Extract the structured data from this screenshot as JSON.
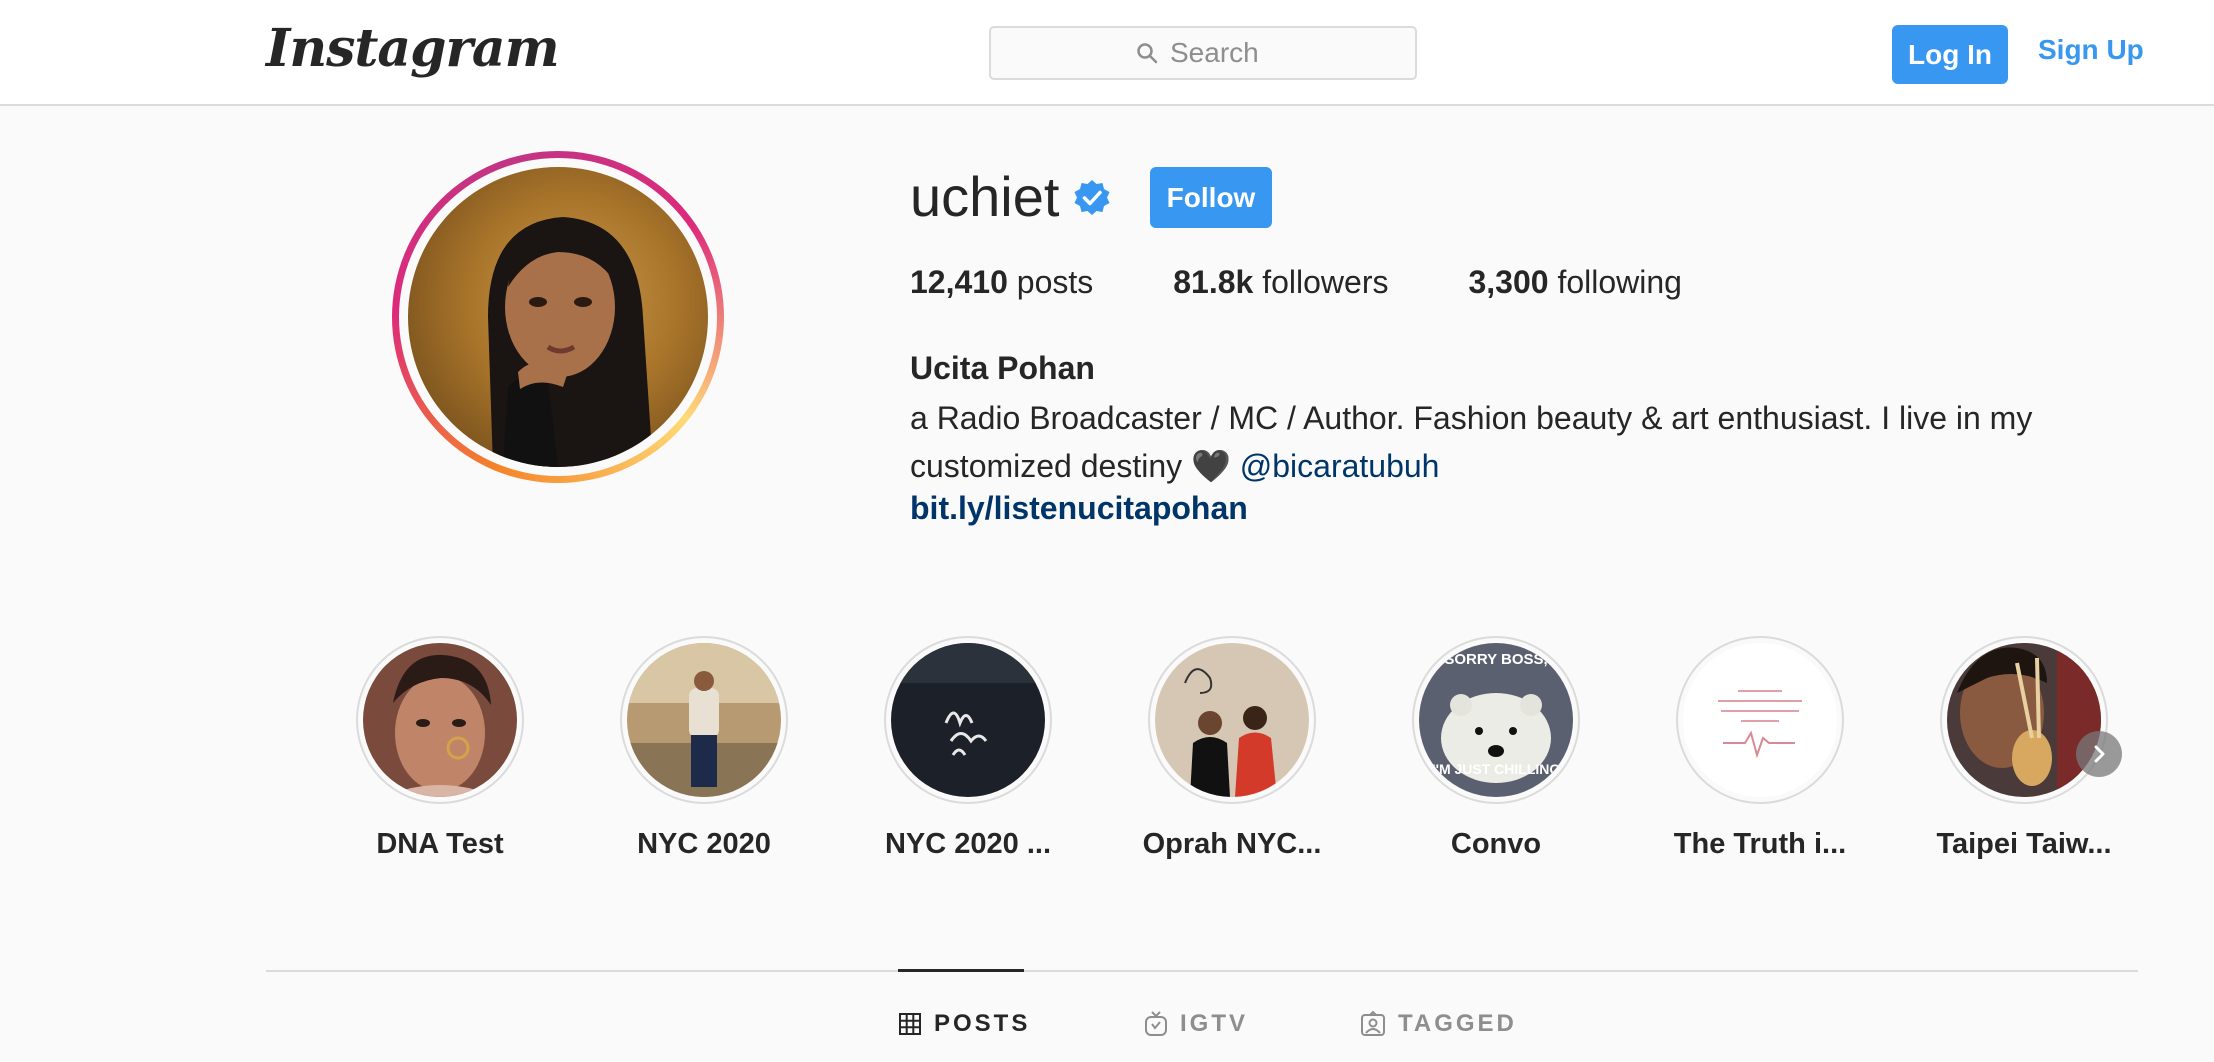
{
  "header": {
    "logo": "Instagram",
    "search_placeholder": "Search",
    "login_label": "Log In",
    "signup_label": "Sign Up"
  },
  "profile": {
    "username": "uchiet",
    "verified": true,
    "follow_label": "Follow",
    "stats": {
      "posts_count": "12,410",
      "posts_label": "posts",
      "followers_count": "81.8k",
      "followers_label": "followers",
      "following_count": "3,300",
      "following_label": "following"
    },
    "full_name": "Ucita Pohan",
    "bio_text": "a Radio Broadcaster / MC / Author. Fashion beauty & art enthusiast. I live in my customized destiny 🖤",
    "bio_mention": "@bicaratubuh",
    "link": "bit.ly/listenucitapohan"
  },
  "highlights": [
    {
      "label": "DNA Test"
    },
    {
      "label": "NYC 2020"
    },
    {
      "label": "NYC 2020 ..."
    },
    {
      "label": "Oprah NYC..."
    },
    {
      "label": "Convo",
      "cover_top_text": "SORRY BOSS,",
      "cover_bottom_text": "I'M JUST CHILLING"
    },
    {
      "label": "The Truth i..."
    },
    {
      "label": "Taipei Taiw..."
    }
  ],
  "tabs": [
    {
      "label": "POSTS",
      "icon": "grid-icon",
      "active": true
    },
    {
      "label": "IGTV",
      "icon": "igtv-icon",
      "active": false
    },
    {
      "label": "TAGGED",
      "icon": "tagged-icon",
      "active": false
    }
  ],
  "colors": {
    "accent": "#3897f0",
    "link": "#003569",
    "text": "#262626",
    "muted": "#8e8e8e",
    "border": "#dbdbdb",
    "background": "#fafafa"
  }
}
